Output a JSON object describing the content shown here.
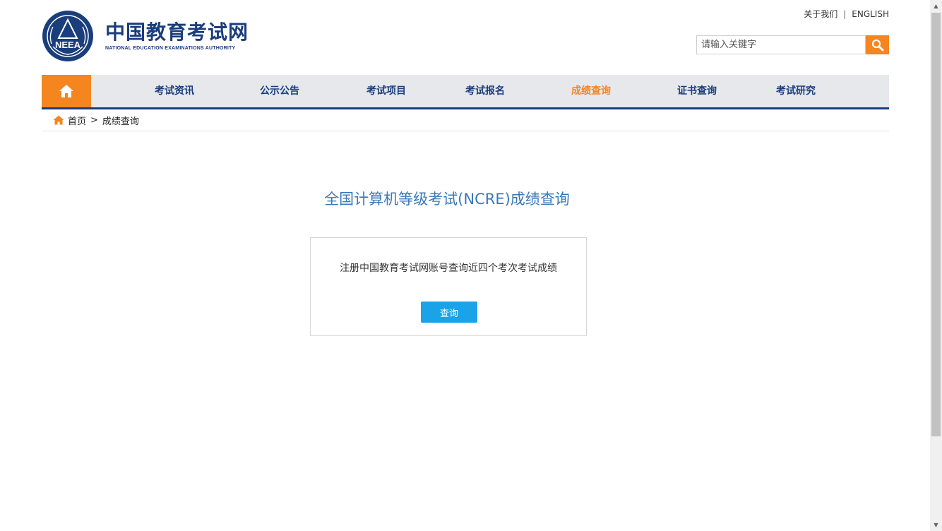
{
  "header": {
    "logo_cn": "中国教育考试网",
    "logo_en": "NATIONAL EDUCATION EXAMINATIONS AUTHORITY",
    "emblem_text": "NEEA",
    "top_links": {
      "about": "关于我们",
      "separator": "|",
      "english": "ENGLISH"
    },
    "search": {
      "placeholder": "请输入关键字",
      "icon": "search-icon"
    }
  },
  "nav": {
    "home_icon": "home-icon",
    "items": [
      {
        "label": "考试资讯"
      },
      {
        "label": "公示公告"
      },
      {
        "label": "考试项目"
      },
      {
        "label": "考试报名"
      },
      {
        "label": "成绩查询",
        "active": true
      },
      {
        "label": "证书查询"
      },
      {
        "label": "考试研究"
      }
    ]
  },
  "breadcrumb": {
    "home": "首页",
    "separator": ">",
    "current": "成绩查询"
  },
  "main": {
    "title": "全国计算机等级考试(NCRE)成绩查询",
    "card": {
      "description": "注册中国教育考试网账号查询近四个考次考试成绩",
      "button": "查询"
    }
  },
  "colors": {
    "primary": "#1a3d7c",
    "accent": "#f5851f",
    "title": "#3a78b8",
    "button": "#1aa3e8"
  }
}
